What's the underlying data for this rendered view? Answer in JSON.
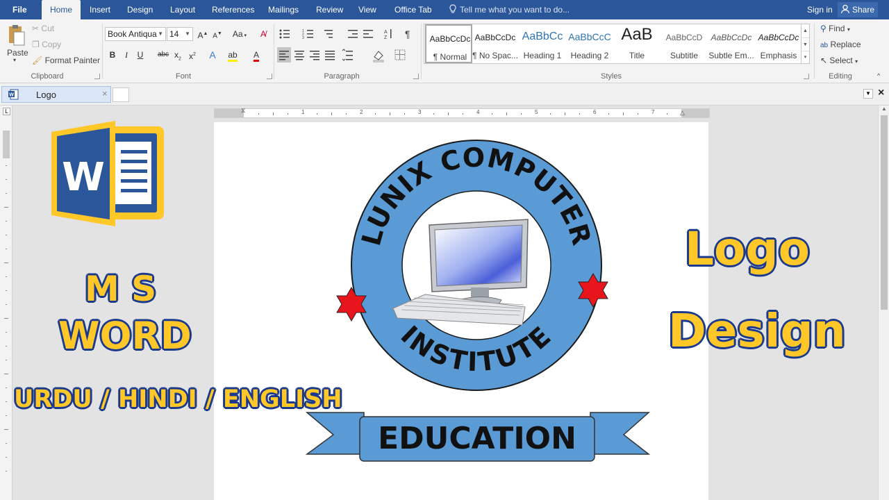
{
  "ribbon_tabs": [
    {
      "label": "File"
    },
    {
      "label": "Home"
    },
    {
      "label": "Insert"
    },
    {
      "label": "Design"
    },
    {
      "label": "Layout"
    },
    {
      "label": "References"
    },
    {
      "label": "Mailings"
    },
    {
      "label": "Review"
    },
    {
      "label": "View"
    },
    {
      "label": "Office Tab"
    }
  ],
  "tell_me": "Tell me what you want to do...",
  "sign_in": "Sign in",
  "share": "Share",
  "clipboard": {
    "paste": "Paste",
    "cut": "Cut",
    "copy": "Copy",
    "format_painter": "Format Painter",
    "label": "Clipboard"
  },
  "font": {
    "name": "Book Antiqua",
    "size": "14",
    "label": "Font",
    "case_button": "Aa"
  },
  "paragraph": {
    "label": "Paragraph"
  },
  "styles": {
    "label": "Styles",
    "items": [
      {
        "sample": "AaBbCcDc",
        "name": "¶ Normal"
      },
      {
        "sample": "AaBbCcDc",
        "name": "¶ No Spac..."
      },
      {
        "sample": "AaBbCc",
        "name": "Heading 1"
      },
      {
        "sample": "AaBbCcC",
        "name": "Heading 2"
      },
      {
        "sample": "AaB",
        "name": "Title"
      },
      {
        "sample": "AaBbCcD",
        "name": "Subtitle"
      },
      {
        "sample": "AaBbCcDc",
        "name": "Subtle Em..."
      },
      {
        "sample": "AaBbCcDc",
        "name": "Emphasis"
      }
    ]
  },
  "editing": {
    "find": "Find",
    "replace": "Replace",
    "select": "Select",
    "label": "Editing"
  },
  "document_tab": {
    "title": "Logo"
  },
  "ruler": {
    "numbers": [
      "1",
      "1",
      "2",
      "3",
      "4",
      "5",
      "6",
      "7"
    ]
  },
  "overlay": {
    "ms_line": "M S",
    "word_line": "WORD",
    "languages": "URDU / HINDI / ENGLISH",
    "logo_line": "Logo",
    "design_line": "Design",
    "word_icon_letter": "W"
  },
  "logo": {
    "top_text": "LUNIX COMPUTER",
    "bottom_text": "INSTITUTE",
    "banner_text": "EDUCATION",
    "ring_color": "#5b9bd5",
    "star_color": "#e8161c",
    "banner_color": "#5b9bd5"
  },
  "colors": {
    "word_blue": "#2b579a",
    "accent_yellow": "#ffc728",
    "outline_navy": "#1b3a8c"
  }
}
